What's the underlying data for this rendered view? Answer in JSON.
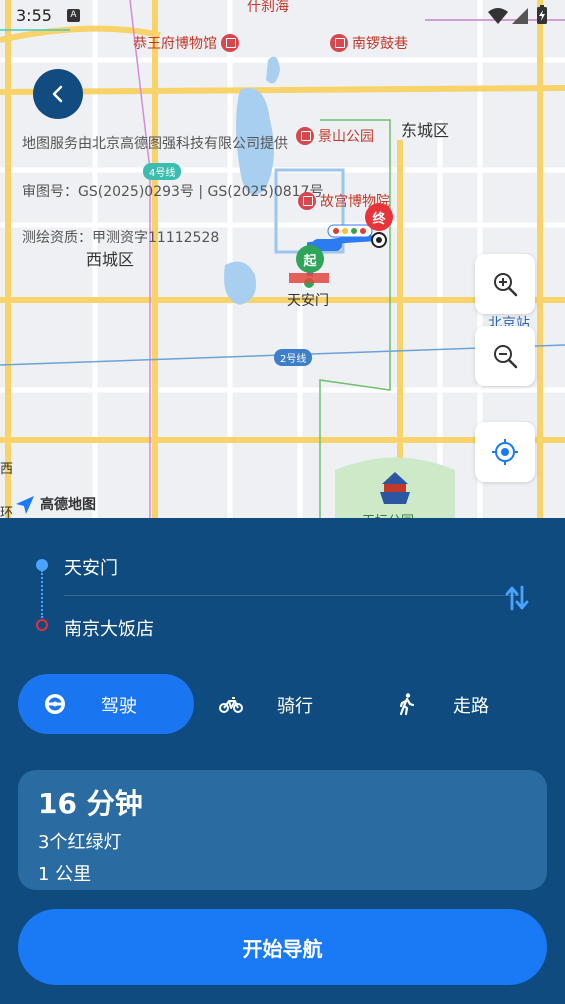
{
  "status_bar": {
    "time": "3:55",
    "notification_letter": "A"
  },
  "map": {
    "labels": {
      "shichahai": "什刹海",
      "gongwangfu": "恭王府博物馆",
      "nanluoguxiang": "南锣鼓巷",
      "jingshan": "景山公园",
      "dongcheng": "东城区",
      "gugong": "故宫博物院",
      "xicheng": "西城区",
      "tiananmen": "天安门",
      "beijingzhan": "北京站",
      "tiantan": "天坛公园",
      "west_edge": "西",
      "west_edge2": "环"
    },
    "metro": {
      "line4": "4号线",
      "line2": "2号线"
    },
    "markers": {
      "start": "起",
      "end": "终"
    },
    "attribution": {
      "provider": "地图服务由北京高德图强科技有限公司提供",
      "review_no": "审图号：GS(2025)0293号 | GS(2025)0817号",
      "survey": "测绘资质：甲测资字11112528"
    },
    "logo_text": "高德地图"
  },
  "route": {
    "origin": "天安门",
    "destination": "南京大饭店"
  },
  "modes": [
    {
      "label": "驾驶",
      "icon": "steering-wheel-icon",
      "active": true
    },
    {
      "label": "骑行",
      "icon": "bicycle-icon",
      "active": false
    },
    {
      "label": "走路",
      "icon": "walking-icon",
      "active": false
    }
  ],
  "summary": {
    "duration": "16 分钟",
    "traffic_lights": "3个红绿灯",
    "distance": "1 公里"
  },
  "start_button": "开始导航",
  "colors": {
    "panel": "#0f4b7e",
    "accent": "#1a79f5",
    "summary_bg": "#2a6ca2",
    "start_marker": "#2fa55a",
    "end_marker": "#e8333a"
  }
}
